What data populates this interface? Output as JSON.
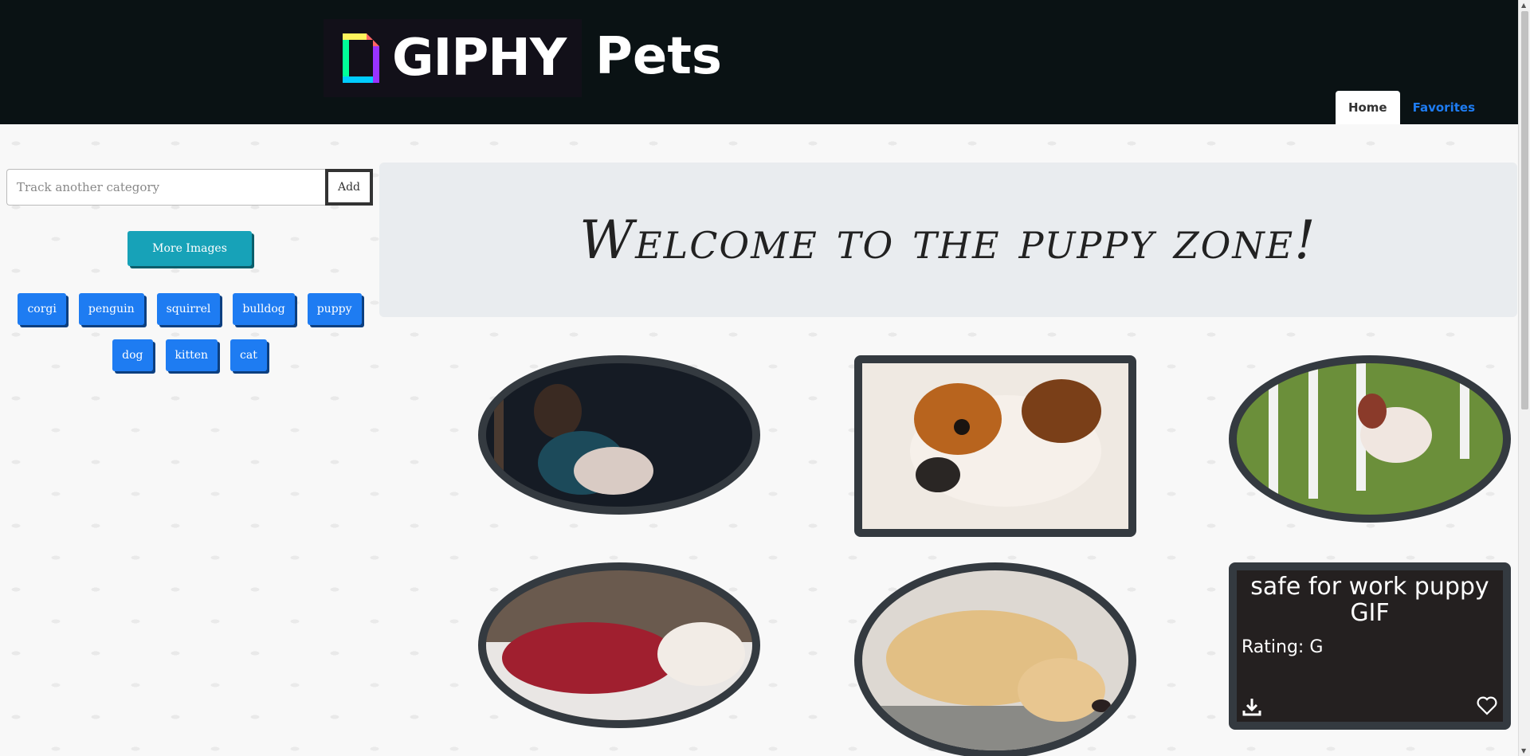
{
  "header": {
    "logo_text": "GIPHY",
    "title": "Pets",
    "nav": [
      {
        "label": "Home",
        "active": true
      },
      {
        "label": "Favorites",
        "active": false
      }
    ]
  },
  "sidebar": {
    "search_placeholder": "Track another category",
    "add_label": "Add",
    "more_label": "More Images",
    "tags_row1": [
      "corgi",
      "penguin",
      "squirrel",
      "bulldog",
      "puppy"
    ],
    "tags_row2": [
      "dog",
      "kitten",
      "cat"
    ]
  },
  "main": {
    "welcome": "Welcome to the puppy zone!",
    "overlay_title": "safe for work puppy GIF",
    "overlay_rating": "Rating: G"
  },
  "colors": {
    "header_bg": "#0a1214",
    "tag_blue": "#1e7cf2",
    "more_teal": "#17a2b8",
    "card_border": "#343a40"
  }
}
